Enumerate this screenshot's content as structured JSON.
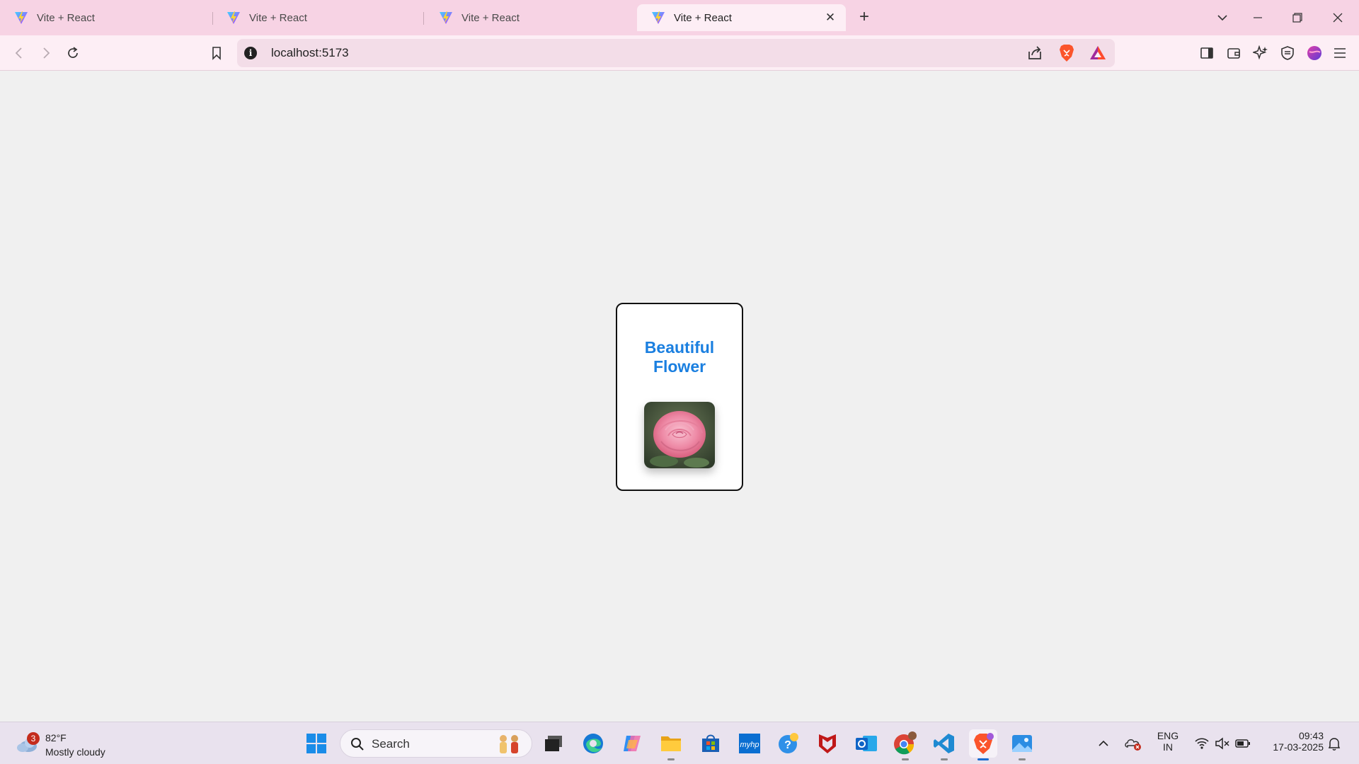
{
  "browser": {
    "tabs": [
      {
        "title": "Vite + React",
        "active": false
      },
      {
        "title": "Vite + React",
        "active": false
      },
      {
        "title": "Vite + React",
        "active": false
      },
      {
        "title": "Vite + React",
        "active": true
      }
    ],
    "url": "localhost:5173"
  },
  "page": {
    "card": {
      "title": "Beautiful Flower",
      "image": "rose-photo"
    }
  },
  "taskbar": {
    "weather": {
      "badge": "3",
      "temperature": "82°F",
      "condition": "Mostly cloudy"
    },
    "search_placeholder": "Search",
    "language": {
      "line1": "ENG",
      "line2": "IN"
    },
    "clock": {
      "time": "09:43",
      "date": "17-03-2025"
    }
  },
  "colors": {
    "tabstrip": "#f7d3e4",
    "toolbar": "#fdeef5",
    "page_background": "#f0f0f0",
    "card_title": "#1a7fe0",
    "taskbar": "#e9e2ee"
  }
}
